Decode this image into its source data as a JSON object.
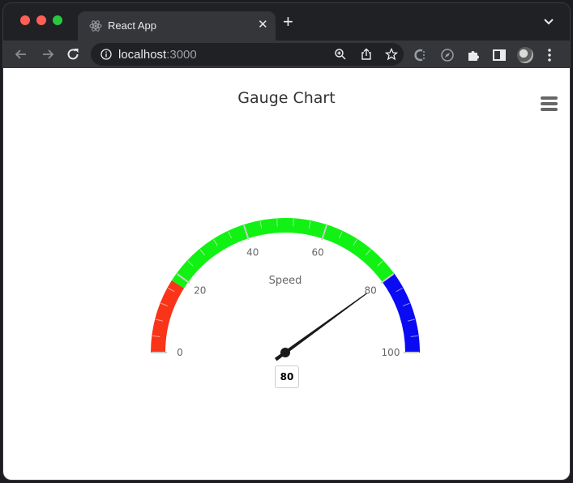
{
  "window": {
    "controls": [
      "close",
      "minimize",
      "zoom"
    ]
  },
  "tab": {
    "title": "React App",
    "icon": "react-icon",
    "close_label": "✕",
    "new_tab_label": "+"
  },
  "address_bar": {
    "host": "localhost",
    "port": ":3000"
  },
  "toolbar_icons": [
    "back-icon",
    "forward-icon",
    "reload-icon",
    "info-icon",
    "zoom-icon",
    "share-icon",
    "bookmark-star-icon",
    "extension-c-icon",
    "compass-icon",
    "puzzle-icon",
    "side-panel-icon",
    "profile-avatar",
    "more-icon"
  ],
  "chart_data": {
    "type": "gauge",
    "title": "Gauge Chart",
    "series_name": "Speed",
    "value": 80,
    "data_label": "80",
    "min": 0,
    "max": 100,
    "tick_labels": [
      "0",
      "20",
      "40",
      "60",
      "80",
      "100"
    ],
    "bands": [
      {
        "from": 0,
        "to": 18,
        "color": "#f93418"
      },
      {
        "from": 18,
        "to": 80,
        "color": "#12f114"
      },
      {
        "from": 80,
        "to": 100,
        "color": "#0a0af3"
      }
    ]
  }
}
